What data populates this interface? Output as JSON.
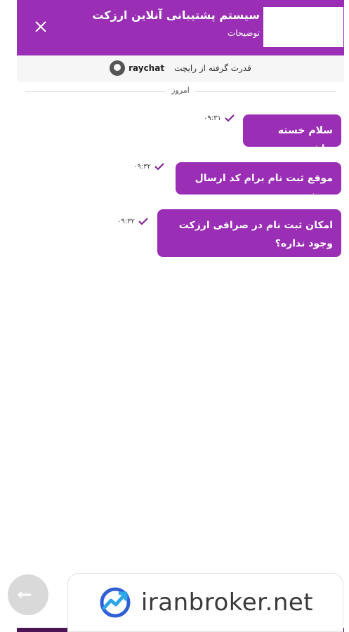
{
  "header": {
    "title": "سیستم پشتیبانی آنلاین ارزکت",
    "subtitle": "توضیحات",
    "close_icon": "close-icon",
    "background": "#9a2eb4"
  },
  "powered_by": {
    "text": "قدرت گرفته از رایچت",
    "brand": "raychat",
    "logo_icon": "raychat-logo-icon"
  },
  "date_separator": "امروز",
  "messages": [
    {
      "text": "سلام خسته نباشید",
      "time": "۰۹:۳۱",
      "status_icon": "check-icon"
    },
    {
      "text": "موقع ثبت نام برام کد ارسال نمیشه",
      "time": "۰۹:۳۲",
      "status_icon": "check-icon"
    },
    {
      "text": "امکان ثبت نام در صرافی ارزکت وجود نداره؟",
      "time": "۰۹:۳۲",
      "status_icon": "check-icon"
    }
  ],
  "watermark": {
    "text": "iranbroker.net",
    "logo_icon": "iranbroker-logo-icon"
  },
  "fab_icon": "arrow-icon",
  "colors": {
    "accent": "#9a2eb4",
    "bubble": "#9a2eb4",
    "check": "#7a1a8e"
  }
}
